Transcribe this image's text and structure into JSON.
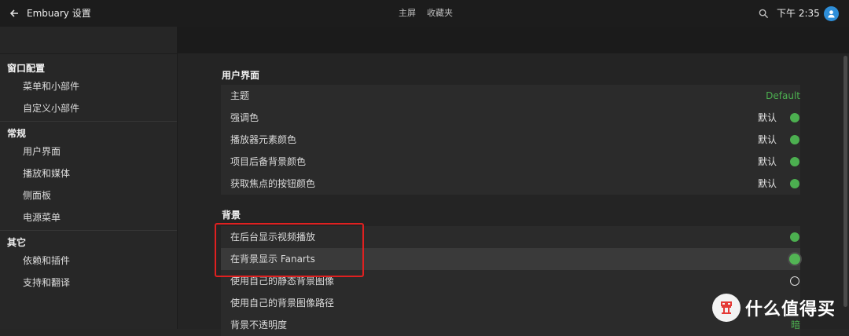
{
  "topbar": {
    "title": "Embuary 设置",
    "tabs": [
      "主屏",
      "收藏夹"
    ],
    "time": "下午 2:35"
  },
  "sidebar": {
    "sections": [
      {
        "title": "窗口配置",
        "items": [
          "菜单和小部件",
          "自定义小部件"
        ]
      },
      {
        "title": "常规",
        "items": [
          "用户界面",
          "播放和媒体",
          "侧面板",
          "电源菜单"
        ]
      },
      {
        "title": "其它",
        "items": [
          "依赖和插件",
          "支持和翻译"
        ]
      }
    ]
  },
  "main": {
    "group1": {
      "title": "用户界面",
      "rows": [
        {
          "label": "主题",
          "value": "Default"
        },
        {
          "label": "强调色",
          "value": "默认"
        },
        {
          "label": "播放器元素颜色",
          "value": "默认"
        },
        {
          "label": "项目后备背景颜色",
          "value": "默认"
        },
        {
          "label": "获取焦点的按钮颜色",
          "value": "默认"
        }
      ]
    },
    "group2": {
      "title": "背景",
      "rows": [
        {
          "label": "在后台显示视频播放"
        },
        {
          "label": "在背景显示 Fanarts"
        },
        {
          "label": "使用自己的静态背景图像"
        },
        {
          "label": "使用自己的背景图像路径"
        },
        {
          "label": "背景不透明度",
          "value": "暗"
        }
      ]
    }
  },
  "colors": {
    "accent": "#4caf50",
    "highlight_box": "#e02020",
    "avatar": "#2e8ed8"
  },
  "watermark": {
    "text": "什么值得买",
    "logo": "值"
  }
}
